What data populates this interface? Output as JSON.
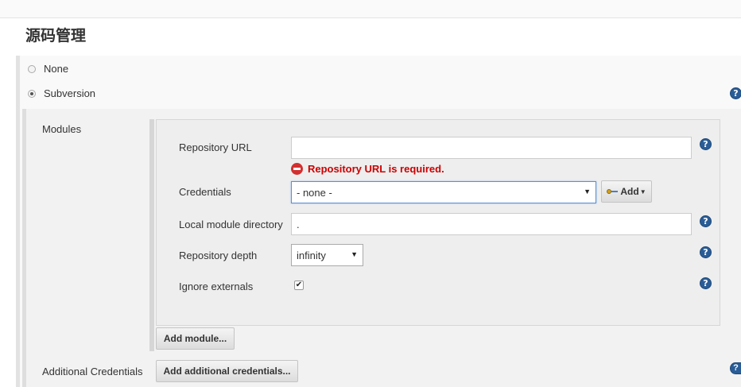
{
  "section": {
    "title": "源码管理"
  },
  "scm": {
    "options": [
      {
        "label": "None",
        "selected": false
      },
      {
        "label": "Subversion",
        "selected": true
      }
    ]
  },
  "modules": {
    "label": "Modules",
    "repository_url": {
      "label": "Repository URL",
      "value": "",
      "placeholder": "",
      "error": "Repository URL is required."
    },
    "credentials": {
      "label": "Credentials",
      "selected": "- none -",
      "add_button": "Add"
    },
    "local_module_directory": {
      "label": "Local module directory",
      "value": "."
    },
    "repository_depth": {
      "label": "Repository depth",
      "selected": "infinity"
    },
    "ignore_externals": {
      "label": "Ignore externals",
      "checked": true,
      "check_glyph": "✔"
    },
    "add_module_button": "Add module..."
  },
  "additional_credentials": {
    "label": "Additional Credentials",
    "button": "Add additional credentials..."
  },
  "icons": {
    "help": "help-icon",
    "help_glyph": "?",
    "error": "error-icon",
    "key": "key-icon",
    "dropdown_glyph": "▼"
  },
  "colors": {
    "help_blue": "#2a5d97",
    "error_red": "#cc0000",
    "focus_blue": "#5a8fd4"
  }
}
